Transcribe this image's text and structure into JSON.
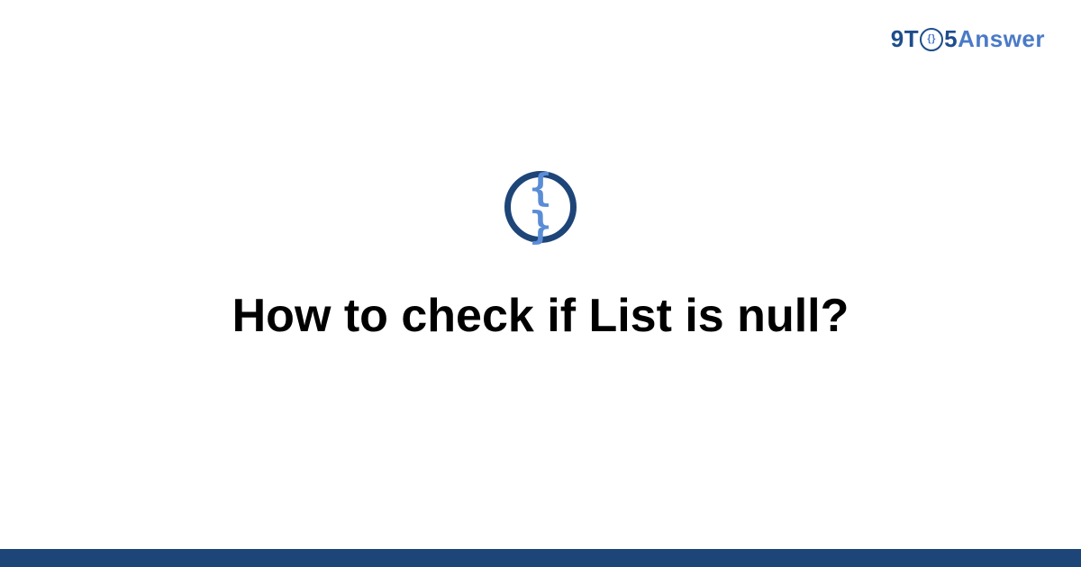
{
  "header": {
    "logo_9t": "9T",
    "logo_clock_inner": "{}",
    "logo_5": "5",
    "logo_answer": "Answer"
  },
  "main": {
    "icon_braces": "{ }",
    "title": "How to check if List is null?"
  },
  "colors": {
    "primary_dark": "#1e4578",
    "primary_light": "#5a8dd6",
    "logo_dark": "#1e4d8c",
    "logo_light": "#4a7ac7"
  }
}
